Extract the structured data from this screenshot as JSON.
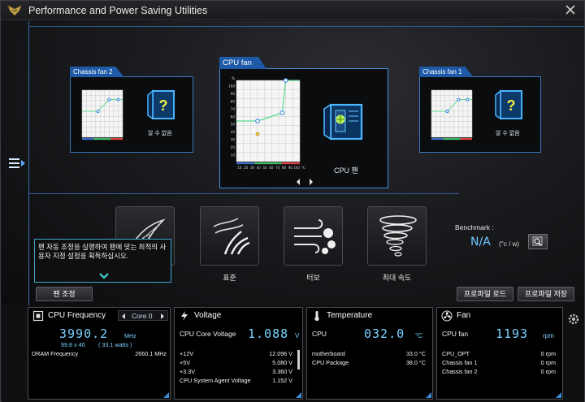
{
  "window": {
    "title": "Performance and Power Saving Utilities"
  },
  "fans": {
    "left": {
      "tab": "Chassis fan 2",
      "status": "알 수 없음"
    },
    "center": {
      "tab": "CPU fan",
      "status": "CPU 팬"
    },
    "right": {
      "tab": "Chassis fan 1",
      "status": "알 수 없음"
    }
  },
  "chart_data": [
    {
      "type": "line",
      "title": "CPU fan",
      "y_ticks": [
        "%",
        "100",
        "90",
        "80",
        "70",
        "60",
        "50",
        "40",
        "30",
        "20",
        "10"
      ],
      "x_ticks": [
        "10",
        "20",
        "30",
        "40",
        "50",
        "60",
        "70",
        "80",
        "90",
        "100"
      ],
      "x_unit": "°C",
      "x": [
        40,
        75,
        80
      ],
      "y": [
        50,
        60,
        100
      ],
      "xlim": [
        10,
        100
      ],
      "ylim": [
        0,
        100
      ]
    },
    {
      "type": "line",
      "title": "Chassis fan 2",
      "x": [
        45,
        70,
        90
      ],
      "y": [
        55,
        80,
        80
      ],
      "xlim": [
        10,
        100
      ],
      "ylim": [
        0,
        100
      ]
    },
    {
      "type": "line",
      "title": "Chassis fan 1",
      "x": [
        45,
        70,
        90
      ],
      "y": [
        55,
        80,
        80
      ],
      "xlim": [
        10,
        100
      ],
      "ylim": [
        0,
        100
      ]
    }
  ],
  "modes": [
    {
      "label": ""
    },
    {
      "label": "표준"
    },
    {
      "label": "터보"
    },
    {
      "label": "최대 속도"
    }
  ],
  "tooltip": {
    "text": "팬 자동 조정을 실행하여 팬에 맞는 최적의 사용자 지정 설정을 획득하십시오."
  },
  "benchmark": {
    "label": "Benchmark :",
    "value": "N/A",
    "unit": "(°c / w)"
  },
  "buttons": {
    "fan_tune": "팬 조정",
    "profile_load": "프로파일 로드",
    "profile_save": "프로파일 저장"
  },
  "cpu": {
    "title": "CPU Frequency",
    "core_select": "Core 0",
    "value": "3990.2",
    "unit": "MHz",
    "sub": "99.8  x  40",
    "watts": "( 33.1  watts )",
    "dram_label": "DRAM Frequency",
    "dram_value": "2660.1  MHz"
  },
  "voltage": {
    "title": "Voltage",
    "core_label": "CPU Core Voltage",
    "core_value": "1.088",
    "unit": "V",
    "rows": [
      {
        "label": "+12V",
        "value": "12.096  V"
      },
      {
        "label": "+5V",
        "value": "5.080  V"
      },
      {
        "label": "+3.3V",
        "value": "3.360  V"
      },
      {
        "label": "CPU System Agent Voltage",
        "value": "1.152  V"
      }
    ]
  },
  "temperature": {
    "title": "Temperature",
    "cpu_label": "CPU",
    "cpu_value": "032.0",
    "unit": "°C",
    "rows": [
      {
        "label": "motherboard",
        "value": "33.0  °C"
      },
      {
        "label": "CPU Package",
        "value": "38.0  °C"
      }
    ]
  },
  "fan": {
    "title": "Fan",
    "cpu_label": "CPU fan",
    "cpu_value": "1193",
    "unit": "rpm",
    "rows": [
      {
        "label": "CPU_OPT",
        "value": "0  rpm"
      },
      {
        "label": "Chassis fan 1",
        "value": "0  rpm"
      },
      {
        "label": "Chassis fan 2",
        "value": "0  rpm"
      }
    ]
  },
  "colors": {
    "accent": "#3a78c0",
    "value_blue": "#78d2ff",
    "curve_green": "#58d88c"
  }
}
